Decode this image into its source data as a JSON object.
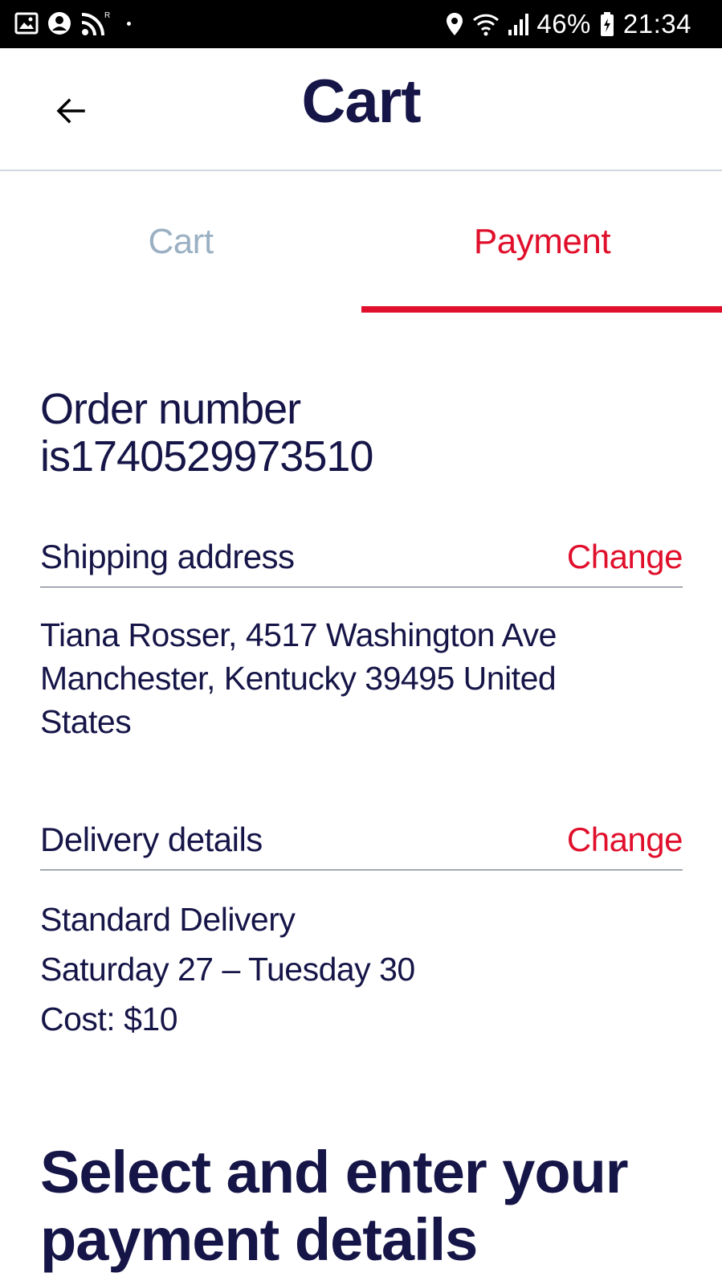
{
  "status_bar": {
    "battery": "46%",
    "time": "21:34",
    "icons": [
      "image-icon",
      "account-icon",
      "rss-icon",
      "location-icon",
      "wifi-icon",
      "signal-icon",
      "battery-icon"
    ]
  },
  "header": {
    "title": "Cart",
    "back_icon": "arrow-left-icon"
  },
  "tabs": [
    {
      "label": "Cart",
      "active": false
    },
    {
      "label": "Payment",
      "active": true
    }
  ],
  "colors": {
    "primary_text": "#161548",
    "accent": "#e0102c",
    "inactive_tab": "#9bb1c3"
  },
  "order": {
    "line1": "Order number",
    "line2": "is1740529973510"
  },
  "shipping": {
    "title": "Shipping address",
    "change_label": "Change",
    "address_lines": [
      "Tiana Rosser, 4517 Washington Ave",
      "Manchester, Kentucky 39495 United",
      "States"
    ]
  },
  "delivery": {
    "title": "Delivery details",
    "change_label": "Change",
    "method": "Standard Delivery",
    "dates": "Saturday 27 – Tuesday 30",
    "cost": "Cost: $10"
  },
  "payment_section": {
    "heading_line1": "Select and enter your",
    "heading_line2": "payment details"
  }
}
